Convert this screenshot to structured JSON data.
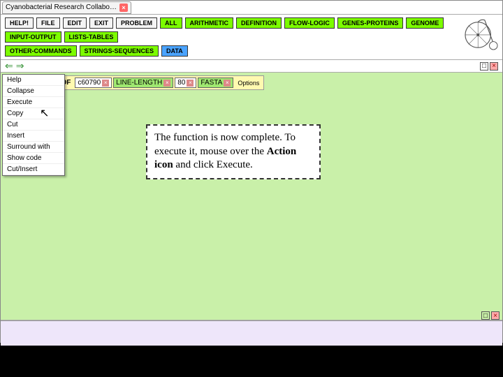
{
  "titlebar": {
    "tab": "Cyanobacterial Research Collabo…"
  },
  "toolbar": {
    "row1": [
      "HELP!",
      "FILE",
      "EDIT",
      "EXIT",
      "PROBLEM",
      "ALL",
      "ARITHMETIC",
      "DEFINITION",
      "FLOW-LOGIC",
      "GENES-PROTEINS",
      "GENOME",
      "INPUT-OUTPUT",
      "LISTS-TABLES"
    ],
    "row2": [
      "OTHER-COMMANDS",
      "STRINGS-SEQUENCES",
      "DATA"
    ]
  },
  "nav": {
    "left": "⇐",
    "right": "⇒",
    "expand": "□",
    "close": "×"
  },
  "command": {
    "label": "SEQUENCE-OF",
    "arg1": "c60790",
    "arg2": "LINE-LENGTH",
    "arg3": "80",
    "arg4": "FASTA",
    "options": "Options"
  },
  "menu": {
    "items": [
      "Help",
      "Collapse",
      "Execute",
      "Copy",
      "Cut",
      "Insert",
      "Surround with",
      "Show code",
      "Cut/Insert"
    ]
  },
  "callout": {
    "t1": "The function is now complete. To execute it, mouse over the ",
    "b1": "Action icon",
    "t2": " and click Execute."
  }
}
